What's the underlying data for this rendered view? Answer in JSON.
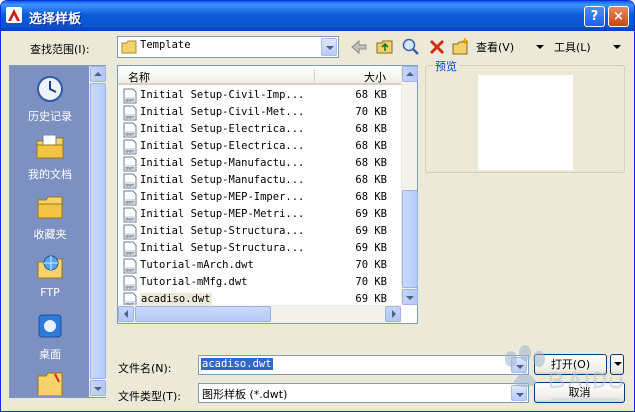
{
  "window": {
    "title": "选择样板"
  },
  "title_buttons": {
    "help": "?",
    "close": "×"
  },
  "lookin": {
    "label": "查找范围(I):",
    "folder": "Template"
  },
  "toolbar": {
    "views_label": "查看(V)",
    "tools_label": "工具(L)"
  },
  "places": [
    {
      "label": "历史记录",
      "icon": "history-icon"
    },
    {
      "label": "我的文档",
      "icon": "my-documents-icon"
    },
    {
      "label": "收藏夹",
      "icon": "favorites-folder-icon"
    },
    {
      "label": "FTP",
      "icon": "ftp-icon"
    },
    {
      "label": "桌面",
      "icon": "desktop-icon"
    }
  ],
  "filelist": {
    "col_name": "名称",
    "col_size": "大小",
    "rows": [
      {
        "name": "Initial Setup-Civil-Imp...",
        "size": "68 KB"
      },
      {
        "name": "Initial Setup-Civil-Met...",
        "size": "70 KB"
      },
      {
        "name": "Initial Setup-Electrica...",
        "size": "68 KB"
      },
      {
        "name": "Initial Setup-Electrica...",
        "size": "68 KB"
      },
      {
        "name": "Initial Setup-Manufactu...",
        "size": "68 KB"
      },
      {
        "name": "Initial Setup-Manufactu...",
        "size": "68 KB"
      },
      {
        "name": "Initial Setup-MEP-Imper...",
        "size": "68 KB"
      },
      {
        "name": "Initial Setup-MEP-Metri...",
        "size": "69 KB"
      },
      {
        "name": "Initial Setup-Structura...",
        "size": "69 KB"
      },
      {
        "name": "Initial Setup-Structura...",
        "size": "69 KB"
      },
      {
        "name": "Tutorial-mArch.dwt",
        "size": "70 KB"
      },
      {
        "name": "Tutorial-mMfg.dwt",
        "size": "70 KB"
      },
      {
        "name": "acadiso.dwt",
        "size": "69 KB",
        "selected": true
      }
    ]
  },
  "preview": {
    "label": "预览"
  },
  "filename": {
    "label": "文件名(N):",
    "value": "acadiso.dwt"
  },
  "filetype": {
    "label": "文件类型(T):",
    "value": "图形样板 (*.dwt)"
  },
  "buttons": {
    "open": "打开(O)",
    "cancel": "取消"
  },
  "colors": {
    "title_bar": "#0552d4",
    "dialog_bg": "#ece9d8",
    "places_bg": "#7c91c2",
    "selection": "#316ac5"
  }
}
